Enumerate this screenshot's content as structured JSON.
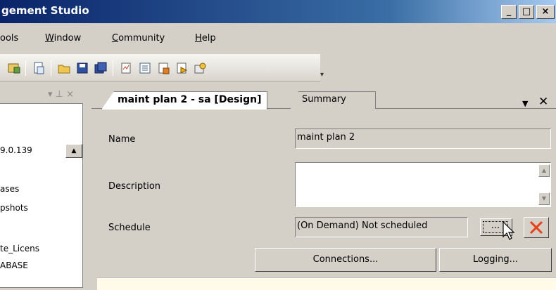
{
  "window": {
    "title": "gement Studio",
    "minimize": "_",
    "maximize": "□",
    "close": "×"
  },
  "menu": {
    "items": [
      {
        "label": "ools",
        "underline": ""
      },
      {
        "label": "Window",
        "underline": "W"
      },
      {
        "label": "Community",
        "underline": "C"
      },
      {
        "label": "Help",
        "underline": "H"
      }
    ]
  },
  "left_pane": {
    "pin_glyph": "▾ ⊥ ×",
    "items": [
      "9.0.139",
      "ases",
      "pshots",
      "te_Licens",
      "ABASE"
    ]
  },
  "tabs": {
    "active": "maint plan 2 - sa [Design]",
    "other": "Summary",
    "dropdown_glyph": "▼",
    "close_glyph": "✕"
  },
  "form": {
    "name_label": "Name",
    "name_value": "maint plan 2",
    "description_label": "Description",
    "description_value": "",
    "schedule_label": "Schedule",
    "schedule_value": "(On Demand) Not scheduled",
    "ellipsis_label": "...",
    "connections_label": "Connections...",
    "logging_label": "Logging..."
  },
  "colors": {
    "title_bar": "#0a246a",
    "clear_icon": "#e8411a"
  }
}
